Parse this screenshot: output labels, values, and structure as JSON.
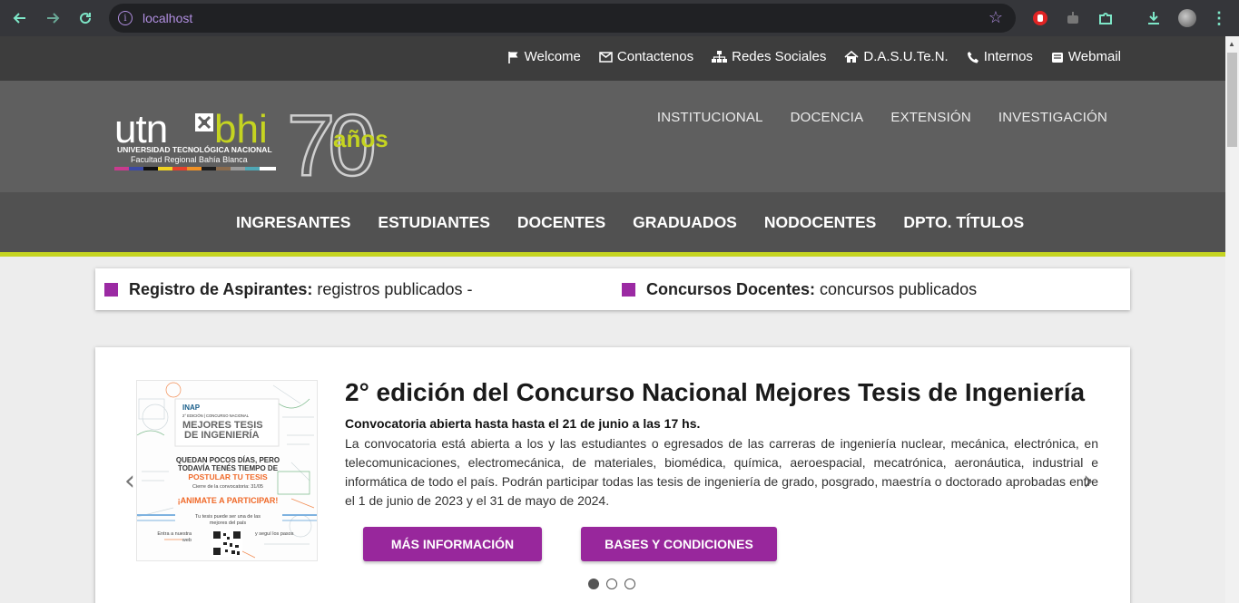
{
  "browser": {
    "url": "localhost"
  },
  "topbar": {
    "links": [
      {
        "label": "Welcome",
        "icon": "flag-icon"
      },
      {
        "label": "Contactenos",
        "icon": "envelope-icon"
      },
      {
        "label": "Redes Sociales",
        "icon": "network-icon"
      },
      {
        "label": "D.A.S.U.Te.N.",
        "icon": "home-icon"
      },
      {
        "label": "Internos",
        "icon": "phone-icon"
      },
      {
        "label": "Webmail",
        "icon": "inbox-icon"
      }
    ]
  },
  "header": {
    "logo": {
      "utn": "utn",
      "bhi": "bhi",
      "line1": "UNIVERSIDAD TECNOLÓGICA NACIONAL",
      "line2": "Facultad Regional Bahía Blanca",
      "anniversary": "70",
      "anos": "años"
    },
    "nav": [
      "INSTITUCIONAL",
      "DOCENCIA",
      "EXTENSIÓN",
      "INVESTIGACIÓN"
    ]
  },
  "subnav": {
    "items": [
      "INGRESANTES",
      "ESTUDIANTES",
      "DOCENTES",
      "GRADUADOS",
      "NODOCENTES",
      "DPTO. TÍTULOS"
    ]
  },
  "ticker": {
    "items": [
      {
        "bold": "Registro de Aspirantes:",
        "text": "registros publicados -"
      },
      {
        "bold": "Concursos Docentes:",
        "text": "concursos publicados"
      }
    ]
  },
  "slide": {
    "title": "2° edición del Concurso Nacional Mejores Tesis de Ingeniería",
    "subtitle": "Convocatoria abierta hasta hasta el 21 de junio a las 17 hs.",
    "body": "La convocatoria está abierta a los y las estudiantes o egresados de las carreras de ingeniería nuclear, mecánica, electrónica, en telecomunicaciones, electromecánica, de materiales, biomédica, química, aeroespacial, mecatrónica, aeronáutica, industrial e informática de todo el país. Podrán participar todas las tesis de ingeniería de grado, posgrado, maestría o doctorado aprobadas entre el 1 de junio de 2023 y el 31 de mayo de 2024.",
    "buttons": [
      "MÁS INFORMACIÓN",
      "BASES Y CONDICIONES"
    ],
    "prev": "‹",
    "next": "›",
    "slide_count": 3,
    "active_slide": 1,
    "poster": {
      "org": "INAP",
      "edition": "2° EDICIÓN | CONCURSO NACIONAL",
      "heading1": "MEJORES TESIS",
      "heading2": "DE INGENIERÍA",
      "line1": "QUEDAN POCOS DÍAS, PERO",
      "line2": "TODAVÍA TENÉS TIEMPO DE",
      "highlight": "POSTULAR TU TESIS",
      "deadline": "Cierre de la convocatoria: 31/05",
      "cta": "¡ANIMATE A PARTICIPAR!",
      "tagline1": "Tu tesis puede ser una de las",
      "tagline2": "mejores del país",
      "left_text": "Entra a nuestra web",
      "right_text": "y seguí los pasos"
    }
  },
  "colors": {
    "accent_purple": "#98279c",
    "lime": "#c5d421",
    "header_gray": "#5f5f5f"
  }
}
